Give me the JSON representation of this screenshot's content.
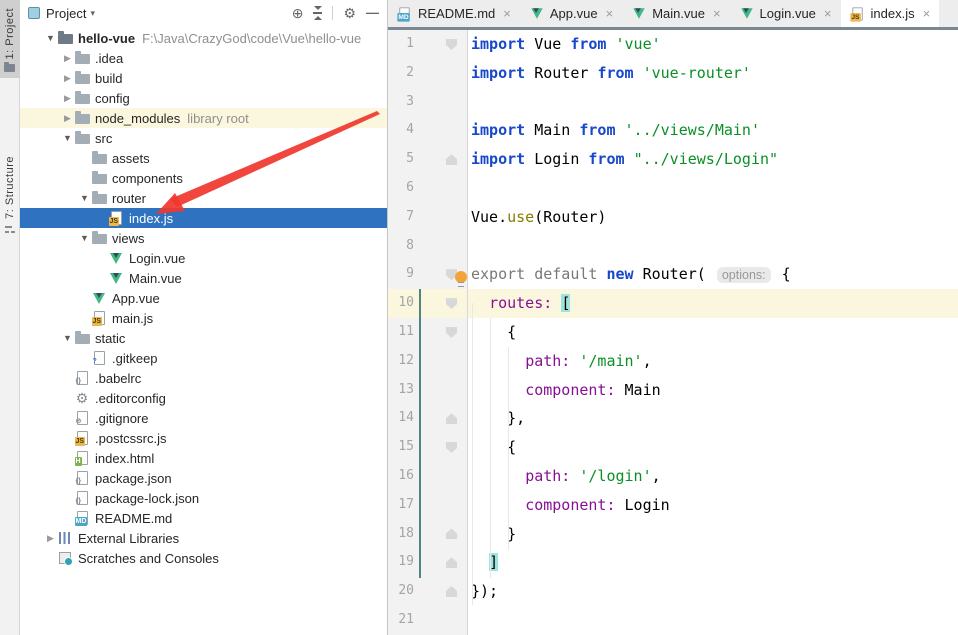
{
  "left_stripe": {
    "items": [
      {
        "label": "1: Project",
        "icon": "folder-mini",
        "active": true
      },
      {
        "label": "7: Structure",
        "icon": "structure",
        "active": false
      }
    ]
  },
  "project_panel": {
    "header": {
      "title": "Project",
      "dropdown_glyph": "▾",
      "icons": [
        "locate",
        "collapse-all",
        "divider",
        "settings",
        "hide"
      ]
    },
    "tree": [
      {
        "label": "hello-vue",
        "bold": true,
        "suffix": "F:\\Java\\CrazyGod\\code\\Vue\\hello-vue",
        "icon": "folder-root",
        "level": 0,
        "arrow": "open"
      },
      {
        "label": ".idea",
        "icon": "folder",
        "level": 1,
        "arrow": "closed"
      },
      {
        "label": "build",
        "icon": "folder",
        "level": 1,
        "arrow": "closed"
      },
      {
        "label": "config",
        "icon": "folder",
        "level": 1,
        "arrow": "closed"
      },
      {
        "label": "node_modules",
        "suffix": "library root",
        "icon": "folder",
        "level": 1,
        "arrow": "closed",
        "highlight": true
      },
      {
        "label": "src",
        "icon": "folder",
        "level": 1,
        "arrow": "open"
      },
      {
        "label": "assets",
        "icon": "folder",
        "level": 2
      },
      {
        "label": "components",
        "icon": "folder",
        "level": 2
      },
      {
        "label": "router",
        "icon": "folder",
        "level": 2,
        "arrow": "open"
      },
      {
        "label": "index.js",
        "icon": "js",
        "level": 3,
        "selected": true
      },
      {
        "label": "views",
        "icon": "folder",
        "level": 2,
        "arrow": "open"
      },
      {
        "label": "Login.vue",
        "icon": "vue",
        "level": 3
      },
      {
        "label": "Main.vue",
        "icon": "vue",
        "level": 3
      },
      {
        "label": "App.vue",
        "icon": "vue",
        "level": 2
      },
      {
        "label": "main.js",
        "icon": "js",
        "level": 2
      },
      {
        "label": "static",
        "icon": "folder",
        "level": 1,
        "arrow": "open"
      },
      {
        "label": ".gitkeep",
        "icon": "help",
        "level": 2
      },
      {
        "label": ".babelrc",
        "icon": "json",
        "level": 1
      },
      {
        "label": ".editorconfig",
        "icon": "gear",
        "level": 1
      },
      {
        "label": ".gitignore",
        "icon": "ignore",
        "level": 1
      },
      {
        "label": ".postcssrc.js",
        "icon": "js",
        "level": 1
      },
      {
        "label": "index.html",
        "icon": "html",
        "level": 1
      },
      {
        "label": "package.json",
        "icon": "json",
        "level": 1
      },
      {
        "label": "package-lock.json",
        "icon": "json",
        "level": 1
      },
      {
        "label": "README.md",
        "icon": "md",
        "level": 1
      },
      {
        "label": "External Libraries",
        "icon": "libs",
        "level": 0,
        "arrow": "closed"
      },
      {
        "label": "Scratches and Consoles",
        "icon": "scratch",
        "level": 0
      }
    ]
  },
  "icons": {
    "folder": {
      "kind": "folder"
    },
    "folder-root": {
      "kind": "folder",
      "dark": true
    },
    "vue": {
      "kind": "vue"
    },
    "js": {
      "kind": "page",
      "badge": "JS",
      "bb": "#edb64e",
      "bf": "#4a3a00"
    },
    "md": {
      "kind": "page",
      "badge": "MD",
      "bb": "#4aa6c9",
      "bf": "#ffffff"
    },
    "html": {
      "kind": "page",
      "badge": "H",
      "bb": "#7cb54e",
      "bf": "#ffffff"
    },
    "json": {
      "kind": "page",
      "badge": "{}",
      "bb": "transparent",
      "bf": "#7a8288"
    },
    "help": {
      "kind": "page",
      "badge": "?",
      "bb": "transparent",
      "bf": "#2e77d0"
    },
    "ignore": {
      "kind": "page",
      "badge": "⊘",
      "bb": "transparent",
      "bf": "#8a8a8a"
    },
    "gear": {
      "kind": "glyph",
      "g": "⚙"
    },
    "libs": {
      "kind": "bars"
    },
    "scratch": {
      "kind": "scratch"
    }
  },
  "tabs": [
    {
      "label": "README.md",
      "icon": "md",
      "close_glyph": "×"
    },
    {
      "label": "App.vue",
      "icon": "vue",
      "close_glyph": "×"
    },
    {
      "label": "Main.vue",
      "icon": "vue",
      "close_glyph": "×"
    },
    {
      "label": "Login.vue",
      "icon": "vue",
      "close_glyph": "×"
    },
    {
      "label": "index.js",
      "icon": "js",
      "close_glyph": "×",
      "active": true
    }
  ],
  "editor": {
    "current_line": 10,
    "folds": {
      "1": "d",
      "5": "u",
      "9": "d",
      "10": "d",
      "11": "d",
      "14": "u",
      "15": "d",
      "18": "u",
      "19": "u",
      "20": "u"
    },
    "lines": [
      {
        "num": 1,
        "tokens": [
          {
            "t": "import",
            "c": "kw"
          },
          {
            "t": " Vue ",
            "c": "p"
          },
          {
            "t": "from",
            "c": "kw"
          },
          {
            "t": " ",
            "c": "p"
          },
          {
            "t": "'vue'",
            "c": "s"
          }
        ]
      },
      {
        "num": 2,
        "tokens": [
          {
            "t": "import",
            "c": "kw"
          },
          {
            "t": " Router ",
            "c": "p"
          },
          {
            "t": "from",
            "c": "kw"
          },
          {
            "t": " ",
            "c": "p"
          },
          {
            "t": "'vue-router'",
            "c": "s"
          }
        ]
      },
      {
        "num": 3,
        "tokens": []
      },
      {
        "num": 4,
        "tokens": [
          {
            "t": "import",
            "c": "kw"
          },
          {
            "t": " Main ",
            "c": "p"
          },
          {
            "t": "from",
            "c": "kw"
          },
          {
            "t": " ",
            "c": "p"
          },
          {
            "t": "'../views/Main'",
            "c": "s"
          }
        ]
      },
      {
        "num": 5,
        "tokens": [
          {
            "t": "import",
            "c": "kw"
          },
          {
            "t": " Login ",
            "c": "p"
          },
          {
            "t": "from",
            "c": "kw"
          },
          {
            "t": " ",
            "c": "p"
          },
          {
            "t": "\"../views/Login\"",
            "c": "s"
          }
        ]
      },
      {
        "num": 6,
        "tokens": []
      },
      {
        "num": 7,
        "tokens": [
          {
            "t": "Vue.",
            "c": "p"
          },
          {
            "t": "use",
            "c": "o"
          },
          {
            "t": "(Router)",
            "c": "p"
          }
        ]
      },
      {
        "num": 8,
        "tokens": []
      },
      {
        "num": 9,
        "tokens": [
          {
            "t": "export default ",
            "c": "g"
          },
          {
            "t": "new",
            "c": "kw"
          },
          {
            "t": " Router( ",
            "c": "p"
          },
          {
            "t": "options:",
            "c": "h"
          },
          {
            "t": " {",
            "c": "p"
          }
        ]
      },
      {
        "num": 10,
        "tokens": [
          {
            "t": "  ",
            "c": "p"
          },
          {
            "t": "routes:",
            "c": "pr"
          },
          {
            "t": " ",
            "c": "p"
          },
          {
            "t": "[",
            "c": "bh"
          }
        ]
      },
      {
        "num": 11,
        "tokens": [
          {
            "t": "    {",
            "c": "p"
          }
        ]
      },
      {
        "num": 12,
        "tokens": [
          {
            "t": "      ",
            "c": "p"
          },
          {
            "t": "path:",
            "c": "pr"
          },
          {
            "t": " ",
            "c": "p"
          },
          {
            "t": "'/main'",
            "c": "s"
          },
          {
            "t": ",",
            "c": "p"
          }
        ]
      },
      {
        "num": 13,
        "tokens": [
          {
            "t": "      ",
            "c": "p"
          },
          {
            "t": "component:",
            "c": "pr"
          },
          {
            "t": " Main",
            "c": "p"
          }
        ]
      },
      {
        "num": 14,
        "tokens": [
          {
            "t": "    },",
            "c": "p"
          }
        ]
      },
      {
        "num": 15,
        "tokens": [
          {
            "t": "    {",
            "c": "p"
          }
        ]
      },
      {
        "num": 16,
        "tokens": [
          {
            "t": "      ",
            "c": "p"
          },
          {
            "t": "path:",
            "c": "pr"
          },
          {
            "t": " ",
            "c": "p"
          },
          {
            "t": "'/login'",
            "c": "s"
          },
          {
            "t": ",",
            "c": "p"
          }
        ]
      },
      {
        "num": 17,
        "tokens": [
          {
            "t": "      ",
            "c": "p"
          },
          {
            "t": "component:",
            "c": "pr"
          },
          {
            "t": " Login",
            "c": "p"
          }
        ]
      },
      {
        "num": 18,
        "tokens": [
          {
            "t": "    }",
            "c": "p"
          }
        ]
      },
      {
        "num": 19,
        "tokens": [
          {
            "t": "  ",
            "c": "p"
          },
          {
            "t": "]",
            "c": "bh"
          }
        ]
      },
      {
        "num": 20,
        "tokens": [
          {
            "t": "});",
            "c": "p"
          }
        ]
      },
      {
        "num": 21,
        "tokens": []
      }
    ]
  },
  "colors": {
    "selection_blue": "#2f72bf",
    "highlight_yellow": "#fbf6de",
    "keyword_blue": "#1747cb",
    "string_green": "#0a8f25",
    "property_purple": "#871094",
    "vcs_teal": "#4e8584",
    "arrow_red": "#f0382e",
    "tab_underline": "#7a8894"
  }
}
